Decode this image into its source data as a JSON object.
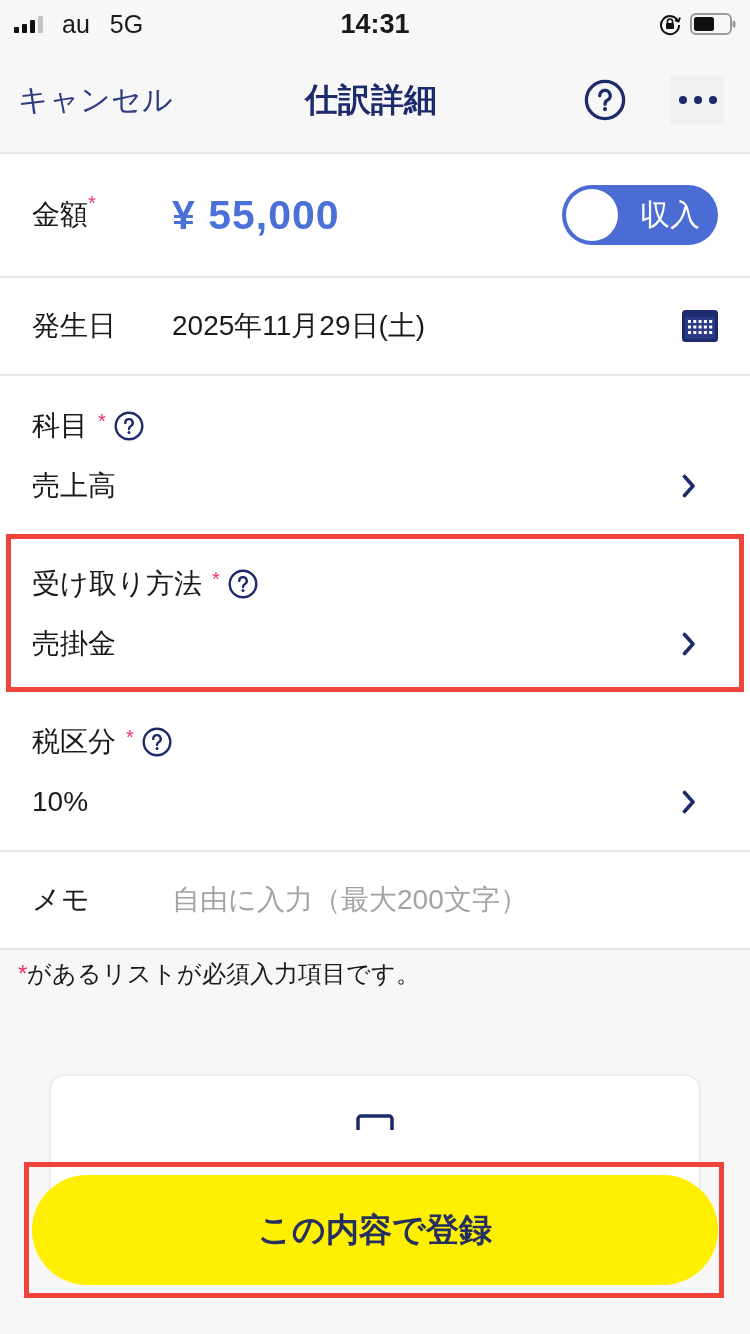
{
  "status_bar": {
    "carrier": "au",
    "network": "5G",
    "time": "14:31"
  },
  "nav": {
    "cancel": "キャンセル",
    "title": "仕訳詳細"
  },
  "amount": {
    "label": "金額",
    "required_mark": "*",
    "value": "¥ 55,000",
    "toggle": {
      "label": "収入",
      "on": true
    }
  },
  "date": {
    "label": "発生日",
    "value": "2025年11月29日(土)"
  },
  "fields": [
    {
      "label": "科目",
      "required_mark": "*",
      "value": "売上高",
      "highlighted": false
    },
    {
      "label": "受け取り方法",
      "required_mark": "*",
      "value": "売掛金",
      "highlighted": true
    },
    {
      "label": "税区分",
      "required_mark": "*",
      "value": "10%",
      "highlighted": false
    }
  ],
  "memo": {
    "label": "メモ",
    "placeholder": "自由に入力（最大200文字）"
  },
  "note": {
    "mark": "*",
    "text": "があるリストが必須入力項目です。"
  },
  "submit": {
    "label": "この内容で登録",
    "highlighted": true
  }
}
